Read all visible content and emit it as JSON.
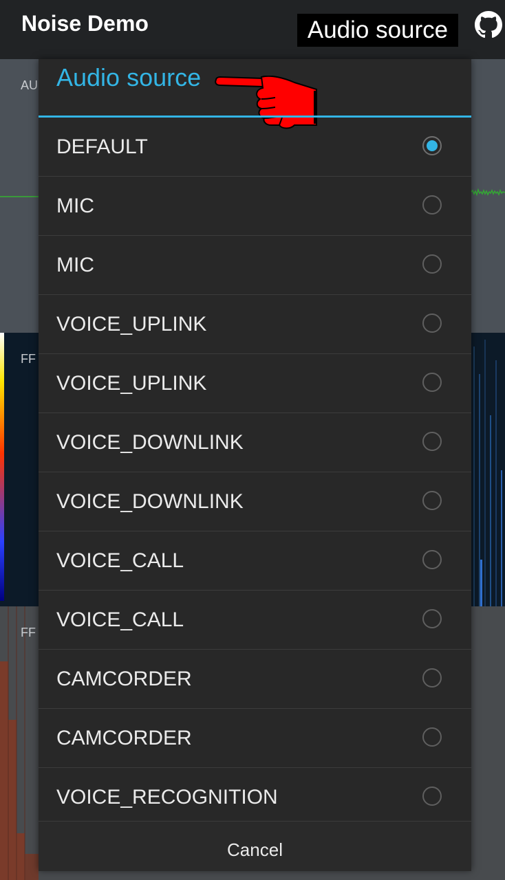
{
  "app_bar": {
    "title": "Noise Demo",
    "action_label": "Audio source",
    "github_icon": "github-icon"
  },
  "background": {
    "audio_panel_label": "AU",
    "fft_spectrogram_label": "FF",
    "fft_panel_label": "FF"
  },
  "dialog": {
    "title": "Audio source",
    "pointer_icon": "pointing-hand-icon",
    "accent_color": "#33b5e5",
    "options": [
      {
        "label": "DEFAULT",
        "selected": true
      },
      {
        "label": "MIC",
        "selected": false
      },
      {
        "label": "MIC",
        "selected": false
      },
      {
        "label": "VOICE_UPLINK",
        "selected": false
      },
      {
        "label": "VOICE_UPLINK",
        "selected": false
      },
      {
        "label": "VOICE_DOWNLINK",
        "selected": false
      },
      {
        "label": "VOICE_DOWNLINK",
        "selected": false
      },
      {
        "label": "VOICE_CALL",
        "selected": false
      },
      {
        "label": "VOICE_CALL",
        "selected": false
      },
      {
        "label": "CAMCORDER",
        "selected": false
      },
      {
        "label": "CAMCORDER",
        "selected": false
      },
      {
        "label": "VOICE_RECOGNITION",
        "selected": false
      }
    ],
    "cancel_label": "Cancel"
  }
}
